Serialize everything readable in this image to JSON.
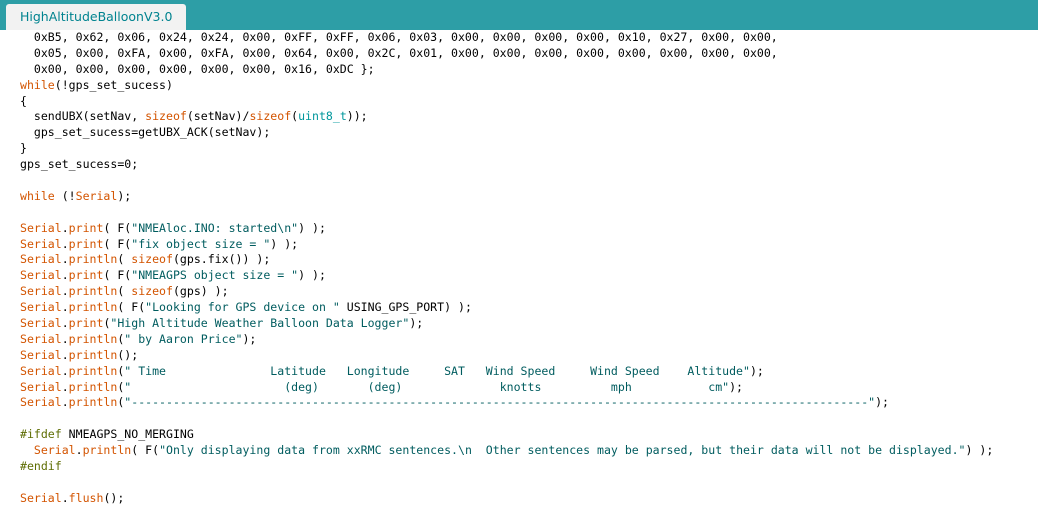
{
  "window": {
    "tab_title": "HighAltitudeBalloonV3.0"
  },
  "colors": {
    "tab_bar": "#2d9ea6",
    "tab_background": "#f2f2f2",
    "tab_text": "#00838f",
    "keyword": "#d35400",
    "type": "#00979c",
    "preprocessor": "#5e6d03",
    "string": "#005c5f",
    "plain": "#000000"
  },
  "editor": {
    "lines": [
      [
        {
          "t": "pl",
          "v": "  0xB5, 0x62, 0x06, 0x24, 0x24, 0x00, 0xFF, 0xFF, 0x06, 0x03, 0x00, 0x00, 0x00, 0x00, 0x10, 0x27, 0x00, 0x00,"
        }
      ],
      [
        {
          "t": "pl",
          "v": "  0x05, 0x00, 0xFA, 0x00, 0xFA, 0x00, 0x64, 0x00, 0x2C, 0x01, 0x00, 0x00, 0x00, 0x00, 0x00, 0x00, 0x00, 0x00,"
        }
      ],
      [
        {
          "t": "pl",
          "v": "  0x00, 0x00, 0x00, 0x00, 0x00, 0x00, 0x16, 0xDC };"
        }
      ],
      [
        {
          "t": "kw",
          "v": "while"
        },
        {
          "t": "pl",
          "v": "(!gps_set_sucess)"
        }
      ],
      [
        {
          "t": "pl",
          "v": "{"
        }
      ],
      [
        {
          "t": "pl",
          "v": "  sendUBX(setNav, "
        },
        {
          "t": "kw",
          "v": "sizeof"
        },
        {
          "t": "pl",
          "v": "(setNav)/"
        },
        {
          "t": "kw",
          "v": "sizeof"
        },
        {
          "t": "pl",
          "v": "("
        },
        {
          "t": "ty",
          "v": "uint8_t"
        },
        {
          "t": "pl",
          "v": "));"
        }
      ],
      [
        {
          "t": "pl",
          "v": "  gps_set_sucess=getUBX_ACK(setNav);"
        }
      ],
      [
        {
          "t": "pl",
          "v": "}"
        }
      ],
      [
        {
          "t": "pl",
          "v": "gps_set_sucess=0;"
        }
      ],
      [
        {
          "t": "pl",
          "v": ""
        }
      ],
      [
        {
          "t": "kw",
          "v": "while"
        },
        {
          "t": "pl",
          "v": " (!"
        },
        {
          "t": "kw",
          "v": "Serial"
        },
        {
          "t": "pl",
          "v": ");"
        }
      ],
      [
        {
          "t": "pl",
          "v": ""
        }
      ],
      [
        {
          "t": "kw",
          "v": "Serial"
        },
        {
          "t": "pl",
          "v": "."
        },
        {
          "t": "kw",
          "v": "print"
        },
        {
          "t": "pl",
          "v": "( F("
        },
        {
          "t": "str",
          "v": "\"NMEAloc.INO: started\\n\""
        },
        {
          "t": "pl",
          "v": ") );"
        }
      ],
      [
        {
          "t": "kw",
          "v": "Serial"
        },
        {
          "t": "pl",
          "v": "."
        },
        {
          "t": "kw",
          "v": "print"
        },
        {
          "t": "pl",
          "v": "( F("
        },
        {
          "t": "str",
          "v": "\"fix object size = \""
        },
        {
          "t": "pl",
          "v": ") );"
        }
      ],
      [
        {
          "t": "kw",
          "v": "Serial"
        },
        {
          "t": "pl",
          "v": "."
        },
        {
          "t": "kw",
          "v": "println"
        },
        {
          "t": "pl",
          "v": "( "
        },
        {
          "t": "kw",
          "v": "sizeof"
        },
        {
          "t": "pl",
          "v": "(gps.fix()) );"
        }
      ],
      [
        {
          "t": "kw",
          "v": "Serial"
        },
        {
          "t": "pl",
          "v": "."
        },
        {
          "t": "kw",
          "v": "print"
        },
        {
          "t": "pl",
          "v": "( F("
        },
        {
          "t": "str",
          "v": "\"NMEAGPS object size = \""
        },
        {
          "t": "pl",
          "v": ") );"
        }
      ],
      [
        {
          "t": "kw",
          "v": "Serial"
        },
        {
          "t": "pl",
          "v": "."
        },
        {
          "t": "kw",
          "v": "println"
        },
        {
          "t": "pl",
          "v": "( "
        },
        {
          "t": "kw",
          "v": "sizeof"
        },
        {
          "t": "pl",
          "v": "(gps) );"
        }
      ],
      [
        {
          "t": "kw",
          "v": "Serial"
        },
        {
          "t": "pl",
          "v": "."
        },
        {
          "t": "kw",
          "v": "println"
        },
        {
          "t": "pl",
          "v": "( F("
        },
        {
          "t": "str",
          "v": "\"Looking for GPS device on \""
        },
        {
          "t": "pl",
          "v": " USING_GPS_PORT) );"
        }
      ],
      [
        {
          "t": "kw",
          "v": "Serial"
        },
        {
          "t": "pl",
          "v": "."
        },
        {
          "t": "kw",
          "v": "print"
        },
        {
          "t": "pl",
          "v": "("
        },
        {
          "t": "str",
          "v": "\"High Altitude Weather Balloon Data Logger\""
        },
        {
          "t": "pl",
          "v": ");"
        }
      ],
      [
        {
          "t": "kw",
          "v": "Serial"
        },
        {
          "t": "pl",
          "v": "."
        },
        {
          "t": "kw",
          "v": "println"
        },
        {
          "t": "pl",
          "v": "("
        },
        {
          "t": "str",
          "v": "\" by Aaron Price\""
        },
        {
          "t": "pl",
          "v": ");"
        }
      ],
      [
        {
          "t": "kw",
          "v": "Serial"
        },
        {
          "t": "pl",
          "v": "."
        },
        {
          "t": "kw",
          "v": "println"
        },
        {
          "t": "pl",
          "v": "();"
        }
      ],
      [
        {
          "t": "kw",
          "v": "Serial"
        },
        {
          "t": "pl",
          "v": "."
        },
        {
          "t": "kw",
          "v": "println"
        },
        {
          "t": "pl",
          "v": "("
        },
        {
          "t": "str",
          "v": "\" Time               Latitude   Longitude     SAT   Wind Speed     Wind Speed    Altitude\""
        },
        {
          "t": "pl",
          "v": ");"
        }
      ],
      [
        {
          "t": "kw",
          "v": "Serial"
        },
        {
          "t": "pl",
          "v": "."
        },
        {
          "t": "kw",
          "v": "println"
        },
        {
          "t": "pl",
          "v": "("
        },
        {
          "t": "str",
          "v": "\"                      (deg)       (deg)              knotts          mph           cm\""
        },
        {
          "t": "pl",
          "v": ");"
        }
      ],
      [
        {
          "t": "kw",
          "v": "Serial"
        },
        {
          "t": "pl",
          "v": "."
        },
        {
          "t": "kw",
          "v": "println"
        },
        {
          "t": "pl",
          "v": "("
        },
        {
          "t": "str",
          "v": "\"----------------------------------------------------------------------------------------------------------\""
        },
        {
          "t": "pl",
          "v": ");"
        }
      ],
      [
        {
          "t": "pl",
          "v": ""
        }
      ],
      [
        {
          "t": "pre",
          "v": "#ifdef"
        },
        {
          "t": "pl",
          "v": " NMEAGPS_NO_MERGING"
        }
      ],
      [
        {
          "t": "pl",
          "v": "  "
        },
        {
          "t": "kw",
          "v": "Serial"
        },
        {
          "t": "pl",
          "v": "."
        },
        {
          "t": "kw",
          "v": "println"
        },
        {
          "t": "pl",
          "v": "( F("
        },
        {
          "t": "str",
          "v": "\"Only displaying data from xxRMC sentences.\\n  Other sentences may be parsed, but their data will not be displayed.\""
        },
        {
          "t": "pl",
          "v": ") );"
        }
      ],
      [
        {
          "t": "pre",
          "v": "#endif"
        }
      ],
      [
        {
          "t": "pl",
          "v": ""
        }
      ],
      [
        {
          "t": "kw",
          "v": "Serial"
        },
        {
          "t": "pl",
          "v": "."
        },
        {
          "t": "kw",
          "v": "flush"
        },
        {
          "t": "pl",
          "v": "();"
        }
      ]
    ]
  }
}
